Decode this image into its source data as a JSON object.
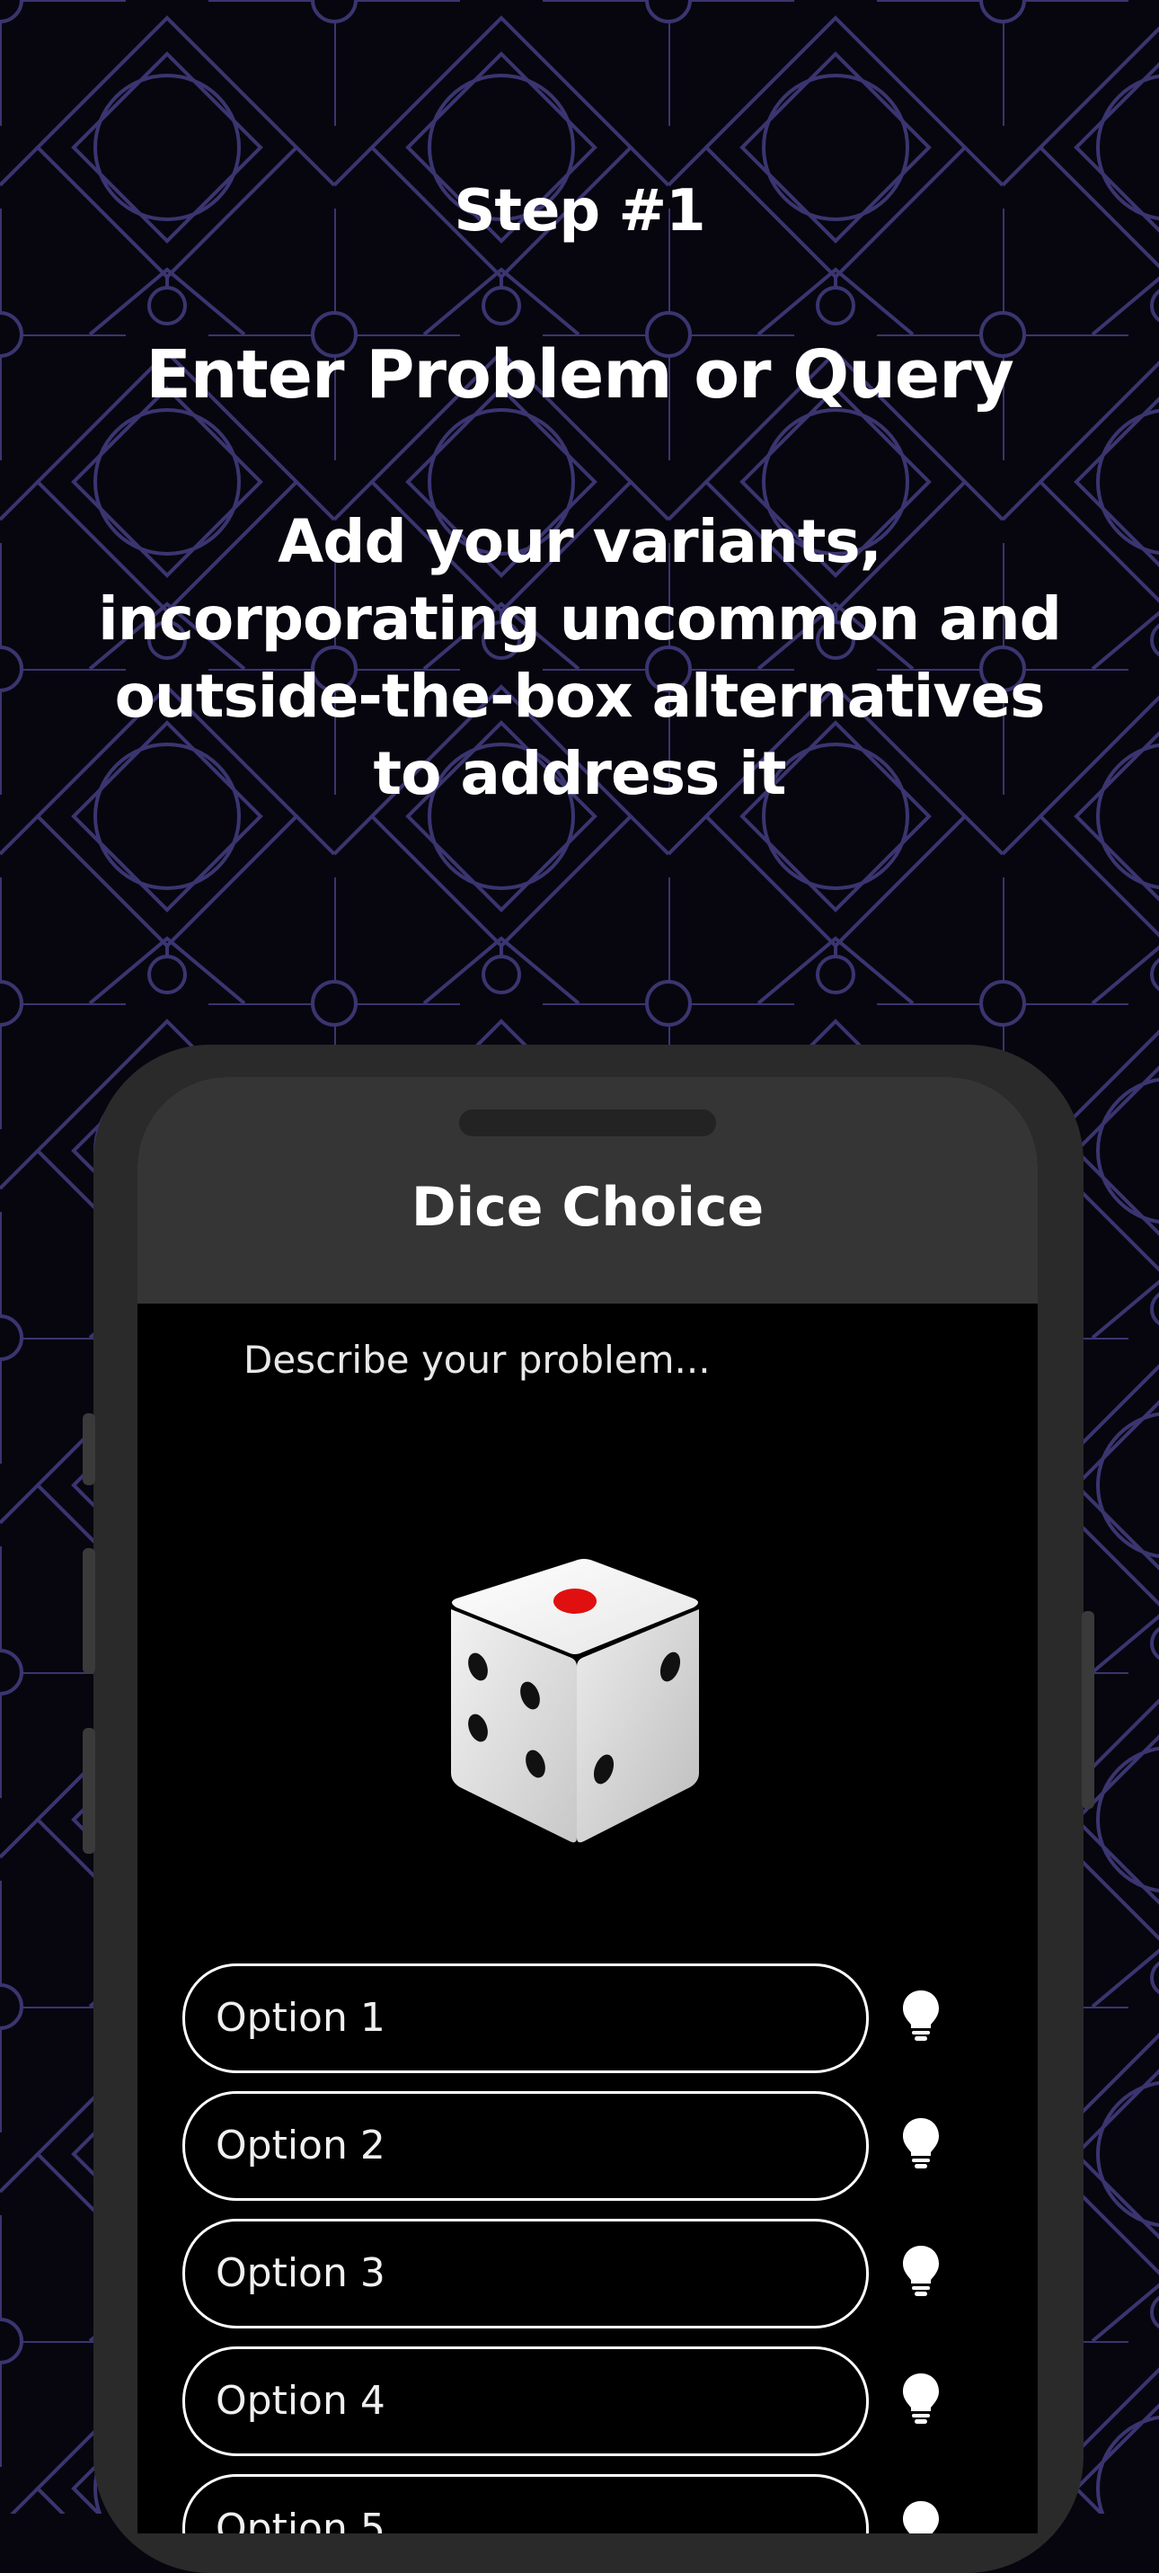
{
  "promo": {
    "step": "Step #1",
    "title": "Enter Problem or Query",
    "subtitle": "Add  your variants, incorporating uncommon and outside-the-box alternatives to address it"
  },
  "app": {
    "title": "Dice Choice",
    "problem_placeholder": "Describe your problem...",
    "options": [
      {
        "label": "Option 1",
        "icon": "lightbulb-icon"
      },
      {
        "label": "Option 2",
        "icon": "lightbulb-icon"
      },
      {
        "label": "Option 3",
        "icon": "lightbulb-icon"
      },
      {
        "label": "Option 4",
        "icon": "lightbulb-icon"
      },
      {
        "label": "Option 5",
        "icon": "lightbulb-icon"
      }
    ]
  },
  "colors": {
    "background": "#07060f",
    "pattern": "#3a3570",
    "nav_bar": "#353535",
    "dice_pip_accent": "#e01010"
  }
}
